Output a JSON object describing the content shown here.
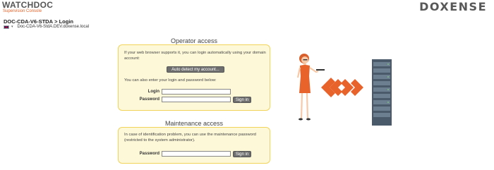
{
  "header": {
    "logo_watchdoc": "WATCHDOC",
    "logo_subtitle": "Supervision Console",
    "logo_doxense": "DOXENSE"
  },
  "breadcrumb": {
    "server": "DOC-CDA-V6-STDA",
    "separator": ">",
    "page": "Login"
  },
  "domain": {
    "language_caret": "▾",
    "name": "Doc-CDA-V6-StdA.DEV.doxense.local"
  },
  "operator": {
    "title": "Operator access",
    "intro": "If your web browser supports it, you can login automatically using your domain account:",
    "autodetect_label": "Auto detect my account...",
    "manual_text": "You can also enter your login and password below:",
    "login_label": "Login",
    "password_label": "Password",
    "signin_label": "Sign in"
  },
  "maintenance": {
    "title": "Maintenance access",
    "intro": "In case of identification problem, you can use the maintenance password (restricted to the system administrator).",
    "password_label": "Password",
    "signin_label": "Sign in"
  },
  "colors": {
    "accent": "#e8632b",
    "box_bg": "#fdf8d8",
    "box_border": "#f2d35a",
    "button": "#6e6e6e"
  }
}
